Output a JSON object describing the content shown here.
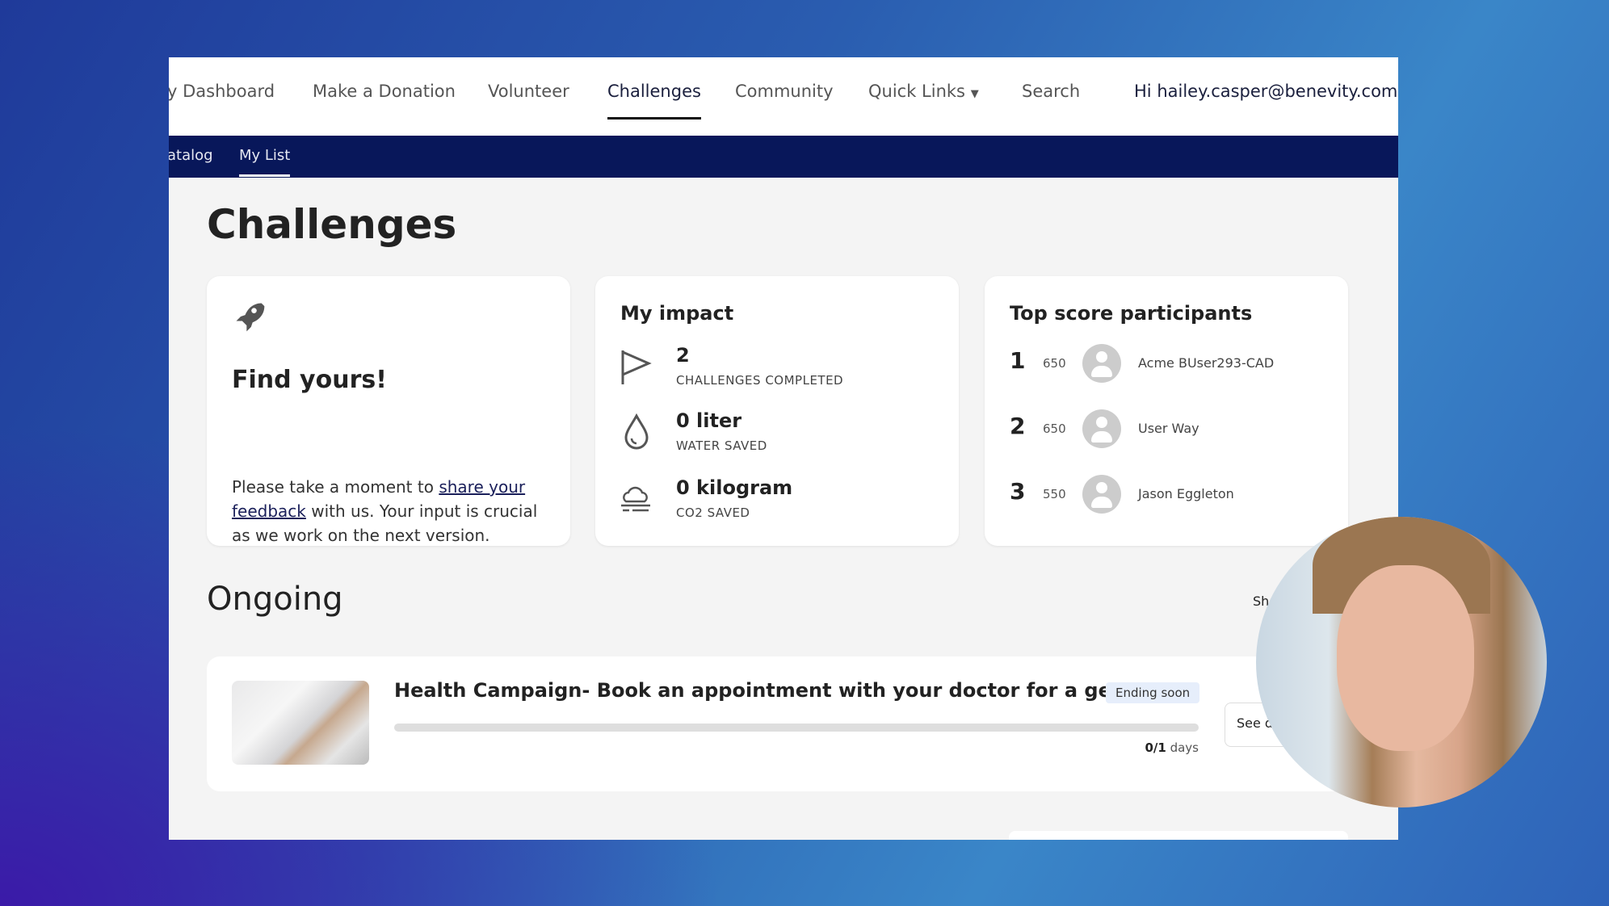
{
  "nav": {
    "items": [
      "y Dashboard",
      "Make a Donation",
      "Volunteer",
      "Challenges",
      "Community",
      "Quick Links",
      "Search"
    ],
    "active": "Challenges",
    "greeting": "Hi",
    "user": "hailey.casper@benevity.com"
  },
  "subnav": {
    "items": [
      "atalog",
      "My List"
    ],
    "active": "My List"
  },
  "page_title": "Challenges",
  "find_card": {
    "title": "Find yours!",
    "text_before": "Please take a moment to ",
    "link": "share your feedback",
    "text_after": " with us. Your input is crucial as we work on the next version."
  },
  "impact": {
    "title": "My impact",
    "items": [
      {
        "icon": "flag-icon",
        "value": "2",
        "label": "CHALLENGES COMPLETED"
      },
      {
        "icon": "water-drop-icon",
        "value": "0 liter",
        "label": "WATER SAVED"
      },
      {
        "icon": "cloud-icon",
        "value": "0 kilogram",
        "label": "CO2 SAVED"
      }
    ]
  },
  "top_scores": {
    "title": "Top score participants",
    "rows": [
      {
        "rank": "1",
        "score": "650",
        "name": "Acme BUser293-CAD"
      },
      {
        "rank": "2",
        "score": "650",
        "name": "User Way"
      },
      {
        "rank": "3",
        "score": "550",
        "name": "Jason Eggleton"
      }
    ]
  },
  "ongoing": {
    "title": "Ongoing",
    "show_link": "Sh",
    "challenge": {
      "title": "Health Campaign- Book an appointment with your doctor for a gen...",
      "badge": "Ending soon",
      "progress": 0,
      "progress_current": "0/1",
      "progress_unit": "days",
      "button": "See d"
    }
  },
  "colors": {
    "nav_dark": "#08175a",
    "background": "#f4f4f4",
    "badge": "#e6eefb"
  }
}
